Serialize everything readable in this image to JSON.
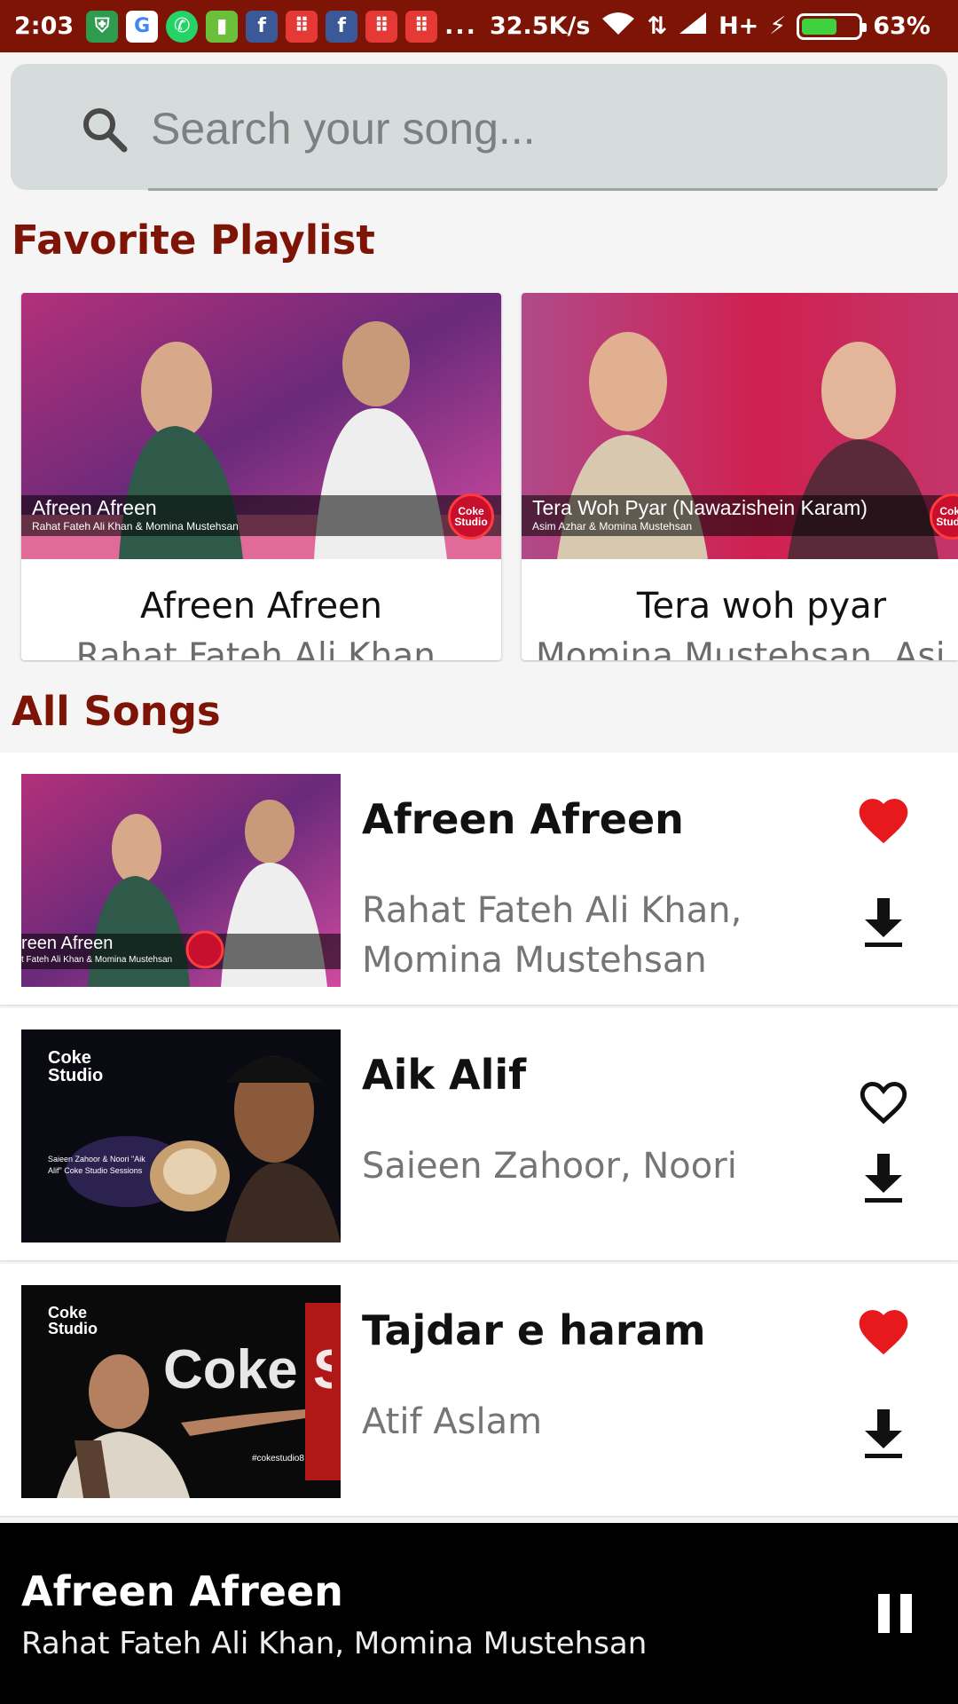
{
  "status_bar": {
    "time": "2:03",
    "net_speed": "32.5K/s",
    "network": "H+",
    "battery": "63%",
    "battery_fraction": 0.63,
    "app_icons": [
      "shield-icon",
      "google-icon",
      "whatsapp-icon",
      "sim-icon",
      "facebook-icon",
      "grid-app-icon",
      "facebook-icon",
      "grid-app-icon",
      "grid-app-icon"
    ],
    "more": "..."
  },
  "search": {
    "placeholder": "Search your song..."
  },
  "favorites": {
    "heading": "Favorite Playlist",
    "cards": [
      {
        "title": "Afreen Afreen",
        "subtitle": "Rahat Fateh Ali Khan,",
        "overlay_title": "Afreen Afreen",
        "overlay_sub": "Rahat Fateh Ali Khan & Momina Mustehsan",
        "badge": "Coke Studio"
      },
      {
        "title": "Tera woh pyar",
        "subtitle": "Momina Mustehsan, Asi",
        "overlay_title": "Tera Woh Pyar (Nawazishein Karam)",
        "overlay_sub": "Asim Azhar & Momina Mustehsan",
        "badge": "Coke Studio"
      }
    ]
  },
  "all_songs": {
    "heading": "All Songs",
    "items": [
      {
        "title": "Afreen Afreen",
        "artist": "Rahat Fateh Ali Khan, Momina Mustehsan",
        "favorite": true,
        "thumb_caption": "reen Afreen",
        "thumb_sub": "t Fateh Ali Khan & Momina Mustehsan",
        "badge": "Coke Studio"
      },
      {
        "title": "Aik Alif",
        "artist": "Saieen Zahoor, Noori",
        "favorite": false,
        "thumb_logo": "Coke Studio",
        "thumb_text": "Saieen Zahoor & Noori \"Aik Alif\" Coke Studio Sessions"
      },
      {
        "title": "Tajdar e haram",
        "artist": "Atif Aslam",
        "favorite": true,
        "thumb_logo": "Coke Studio",
        "thumb_big": "Coke Studio",
        "thumb_tag": "#cokestudio8"
      }
    ]
  },
  "player": {
    "title": "Afreen Afreen",
    "artist": "Rahat Fateh Ali Khan, Momina Mustehsan",
    "state": "playing"
  },
  "colors": {
    "status_bar": "#7d1405",
    "heading": "#7d1405",
    "heart": "#e8191c",
    "search_bg": "#d6dcdb",
    "player_bg": "#000000"
  }
}
